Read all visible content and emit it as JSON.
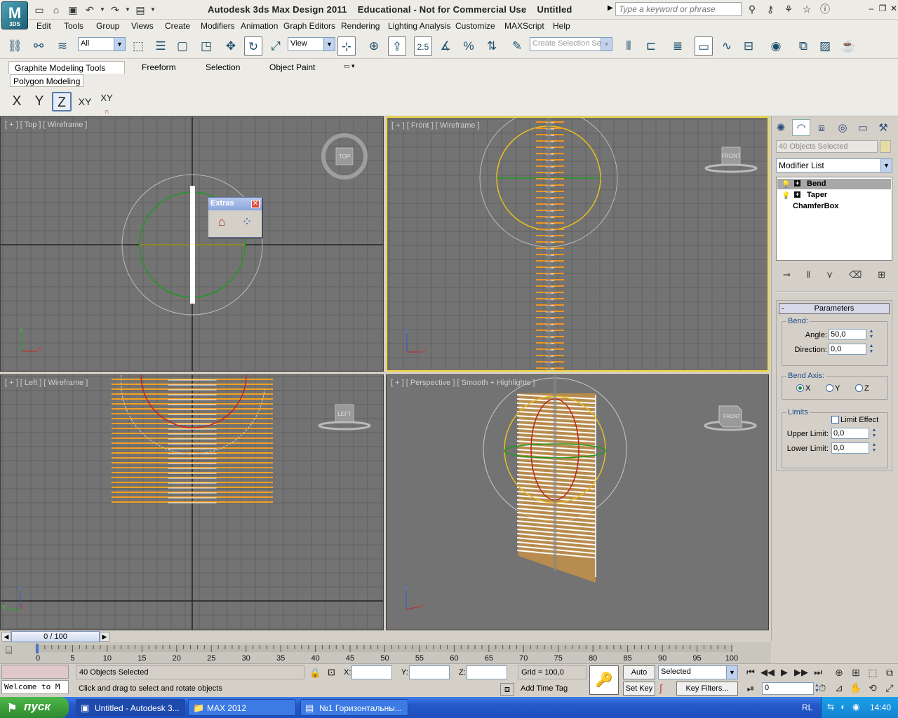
{
  "app": {
    "logo_text": "3DS",
    "window_title": "Autodesk 3ds Max Design 2011    Educational - Not for Commercial Use    Untitled",
    "search_placeholder": "Type a keyword or phrase"
  },
  "menu": [
    "Edit",
    "Tools",
    "Group",
    "Views",
    "Create",
    "Modifiers",
    "Animation",
    "Graph Editors",
    "Rendering",
    "Lighting Analysis",
    "Customize",
    "MAXScript",
    "Help"
  ],
  "toolbar": {
    "selection_filter": "All",
    "reference_coord": "View",
    "snap_value": "2.5",
    "named_selection_placeholder": "Create Selection Se"
  },
  "ribbon": {
    "tabs": [
      "Graphite Modeling Tools",
      "Freeform",
      "Selection",
      "Object Paint"
    ],
    "panel": "Polygon Modeling",
    "axis_buttons": [
      "X",
      "Y",
      "Z",
      "XY",
      "XY"
    ]
  },
  "viewports": {
    "top": {
      "label": "[ + ] [ Top ] [ Wireframe ]",
      "cube": "TOP"
    },
    "front": {
      "label": "[ + ] [ Front ] [ Wireframe ]",
      "cube": "FRONT"
    },
    "left": {
      "label": "[ + ] [ Left ] [ Wireframe ]",
      "cube": "LEFT"
    },
    "perspective": {
      "label": "[ + ] [ Perspective ] [ Smooth + Highlights ]",
      "cube": "FRONT"
    }
  },
  "extras": {
    "title": "Extras"
  },
  "command_panel": {
    "name_field": "40 Objects Selected",
    "modifier_list": "Modifier List",
    "stack": [
      "Bend",
      "Taper",
      "ChamferBox"
    ],
    "rollout_title": "Parameters",
    "bend_group": "Bend:",
    "angle_label": "Angle:",
    "angle_value": "50,0",
    "direction_label": "Direction:",
    "direction_value": "0,0",
    "axis_group": "Bend Axis:",
    "axis_options": [
      "X",
      "Y",
      "Z"
    ],
    "axis_selected": "X",
    "limits_group": "Limits",
    "limit_effect_label": "Limit Effect",
    "upper_label": "Upper Limit:",
    "upper_value": "0,0",
    "lower_label": "Lower Limit:",
    "lower_value": "0,0"
  },
  "timeline": {
    "slider_text": "0 / 100",
    "ticks": [
      "0",
      "5",
      "10",
      "15",
      "20",
      "25",
      "30",
      "35",
      "40",
      "45",
      "50",
      "55",
      "60",
      "65",
      "70",
      "75",
      "80",
      "85",
      "90",
      "95",
      "100"
    ]
  },
  "status": {
    "listener_text": "Welcome to M",
    "selection": "40 Objects Selected",
    "prompt": "Click and drag to select and rotate objects",
    "x_label": "X:",
    "y_label": "Y:",
    "z_label": "Z:",
    "grid": "Grid = 100,0",
    "add_time_tag": "Add Time Tag",
    "auto_key": "Auto Key",
    "set_key": "Set Key",
    "key_mode": "Selected",
    "key_filters": "Key Filters...",
    "frame": "0"
  },
  "taskbar": {
    "start": "пуск",
    "items": [
      "Untitled - Autodesk 3...",
      "MAX 2012",
      "№1 Горизонтальны..."
    ],
    "language": "RL",
    "clock": "14:40"
  }
}
